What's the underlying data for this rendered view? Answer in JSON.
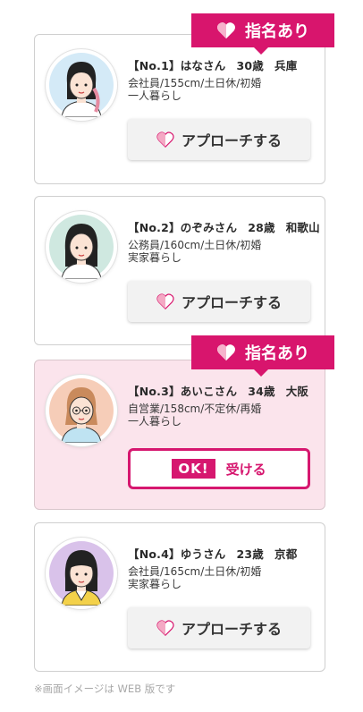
{
  "badge_label": "指名あり",
  "profiles": [
    {
      "title_parts": [
        "【No.1】はなさん",
        "30歳",
        "兵庫"
      ],
      "details": [
        "会社員/155cm/土日休/初婚",
        "一人暮らし"
      ],
      "action_label": "アプローチする"
    },
    {
      "title_parts": [
        "【No.2】のぞみさん",
        "28歳",
        "和歌山"
      ],
      "details": [
        "公務員/160cm/土日休/初婚",
        "実家暮らし"
      ],
      "action_label": "アプローチする"
    },
    {
      "title_parts": [
        "【No.3】あいこさん",
        "34歳",
        "大阪"
      ],
      "details": [
        "自営業/158cm/不定休/再婚",
        "一人暮らし"
      ],
      "ok_label": "OK!",
      "action_label": "受ける"
    },
    {
      "title_parts": [
        "【No.4】ゆうさん",
        "23歳",
        "京都"
      ],
      "details": [
        "会社員/165cm/土日休/初婚",
        "実家暮らし"
      ],
      "action_label": "アプローチする"
    }
  ],
  "footer_note": "※画面イメージは WEB 版です",
  "colors": {
    "accent": "#d8156d",
    "highlight_bg": "#fbe4ec"
  }
}
